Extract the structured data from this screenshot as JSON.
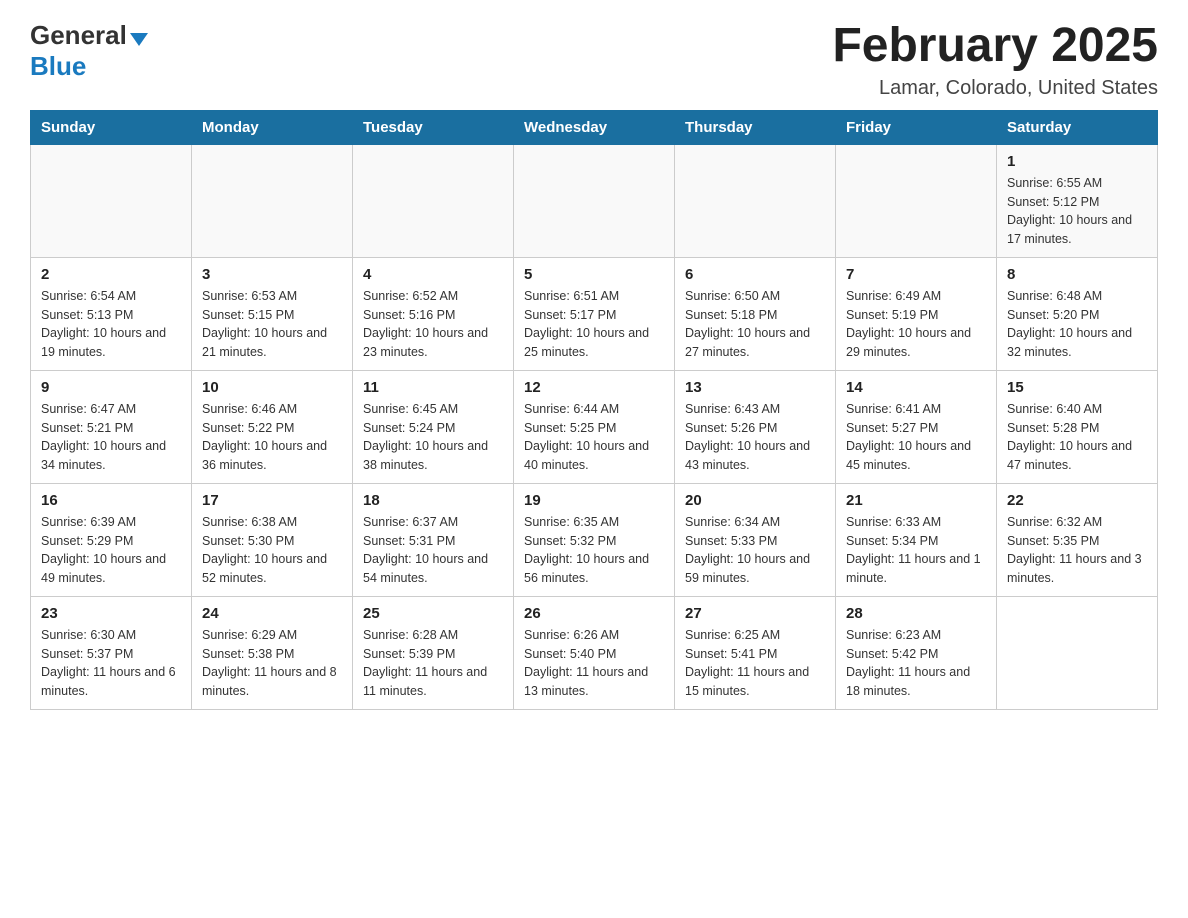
{
  "header": {
    "logo": {
      "general": "General",
      "blue": "Blue",
      "triangle": true
    },
    "title": "February 2025",
    "location": "Lamar, Colorado, United States"
  },
  "days_of_week": [
    "Sunday",
    "Monday",
    "Tuesday",
    "Wednesday",
    "Thursday",
    "Friday",
    "Saturday"
  ],
  "weeks": [
    [
      {
        "day": "",
        "info": ""
      },
      {
        "day": "",
        "info": ""
      },
      {
        "day": "",
        "info": ""
      },
      {
        "day": "",
        "info": ""
      },
      {
        "day": "",
        "info": ""
      },
      {
        "day": "",
        "info": ""
      },
      {
        "day": "1",
        "info": "Sunrise: 6:55 AM\nSunset: 5:12 PM\nDaylight: 10 hours and 17 minutes."
      }
    ],
    [
      {
        "day": "2",
        "info": "Sunrise: 6:54 AM\nSunset: 5:13 PM\nDaylight: 10 hours and 19 minutes."
      },
      {
        "day": "3",
        "info": "Sunrise: 6:53 AM\nSunset: 5:15 PM\nDaylight: 10 hours and 21 minutes."
      },
      {
        "day": "4",
        "info": "Sunrise: 6:52 AM\nSunset: 5:16 PM\nDaylight: 10 hours and 23 minutes."
      },
      {
        "day": "5",
        "info": "Sunrise: 6:51 AM\nSunset: 5:17 PM\nDaylight: 10 hours and 25 minutes."
      },
      {
        "day": "6",
        "info": "Sunrise: 6:50 AM\nSunset: 5:18 PM\nDaylight: 10 hours and 27 minutes."
      },
      {
        "day": "7",
        "info": "Sunrise: 6:49 AM\nSunset: 5:19 PM\nDaylight: 10 hours and 29 minutes."
      },
      {
        "day": "8",
        "info": "Sunrise: 6:48 AM\nSunset: 5:20 PM\nDaylight: 10 hours and 32 minutes."
      }
    ],
    [
      {
        "day": "9",
        "info": "Sunrise: 6:47 AM\nSunset: 5:21 PM\nDaylight: 10 hours and 34 minutes."
      },
      {
        "day": "10",
        "info": "Sunrise: 6:46 AM\nSunset: 5:22 PM\nDaylight: 10 hours and 36 minutes."
      },
      {
        "day": "11",
        "info": "Sunrise: 6:45 AM\nSunset: 5:24 PM\nDaylight: 10 hours and 38 minutes."
      },
      {
        "day": "12",
        "info": "Sunrise: 6:44 AM\nSunset: 5:25 PM\nDaylight: 10 hours and 40 minutes."
      },
      {
        "day": "13",
        "info": "Sunrise: 6:43 AM\nSunset: 5:26 PM\nDaylight: 10 hours and 43 minutes."
      },
      {
        "day": "14",
        "info": "Sunrise: 6:41 AM\nSunset: 5:27 PM\nDaylight: 10 hours and 45 minutes."
      },
      {
        "day": "15",
        "info": "Sunrise: 6:40 AM\nSunset: 5:28 PM\nDaylight: 10 hours and 47 minutes."
      }
    ],
    [
      {
        "day": "16",
        "info": "Sunrise: 6:39 AM\nSunset: 5:29 PM\nDaylight: 10 hours and 49 minutes."
      },
      {
        "day": "17",
        "info": "Sunrise: 6:38 AM\nSunset: 5:30 PM\nDaylight: 10 hours and 52 minutes."
      },
      {
        "day": "18",
        "info": "Sunrise: 6:37 AM\nSunset: 5:31 PM\nDaylight: 10 hours and 54 minutes."
      },
      {
        "day": "19",
        "info": "Sunrise: 6:35 AM\nSunset: 5:32 PM\nDaylight: 10 hours and 56 minutes."
      },
      {
        "day": "20",
        "info": "Sunrise: 6:34 AM\nSunset: 5:33 PM\nDaylight: 10 hours and 59 minutes."
      },
      {
        "day": "21",
        "info": "Sunrise: 6:33 AM\nSunset: 5:34 PM\nDaylight: 11 hours and 1 minute."
      },
      {
        "day": "22",
        "info": "Sunrise: 6:32 AM\nSunset: 5:35 PM\nDaylight: 11 hours and 3 minutes."
      }
    ],
    [
      {
        "day": "23",
        "info": "Sunrise: 6:30 AM\nSunset: 5:37 PM\nDaylight: 11 hours and 6 minutes."
      },
      {
        "day": "24",
        "info": "Sunrise: 6:29 AM\nSunset: 5:38 PM\nDaylight: 11 hours and 8 minutes."
      },
      {
        "day": "25",
        "info": "Sunrise: 6:28 AM\nSunset: 5:39 PM\nDaylight: 11 hours and 11 minutes."
      },
      {
        "day": "26",
        "info": "Sunrise: 6:26 AM\nSunset: 5:40 PM\nDaylight: 11 hours and 13 minutes."
      },
      {
        "day": "27",
        "info": "Sunrise: 6:25 AM\nSunset: 5:41 PM\nDaylight: 11 hours and 15 minutes."
      },
      {
        "day": "28",
        "info": "Sunrise: 6:23 AM\nSunset: 5:42 PM\nDaylight: 11 hours and 18 minutes."
      },
      {
        "day": "",
        "info": ""
      }
    ]
  ]
}
